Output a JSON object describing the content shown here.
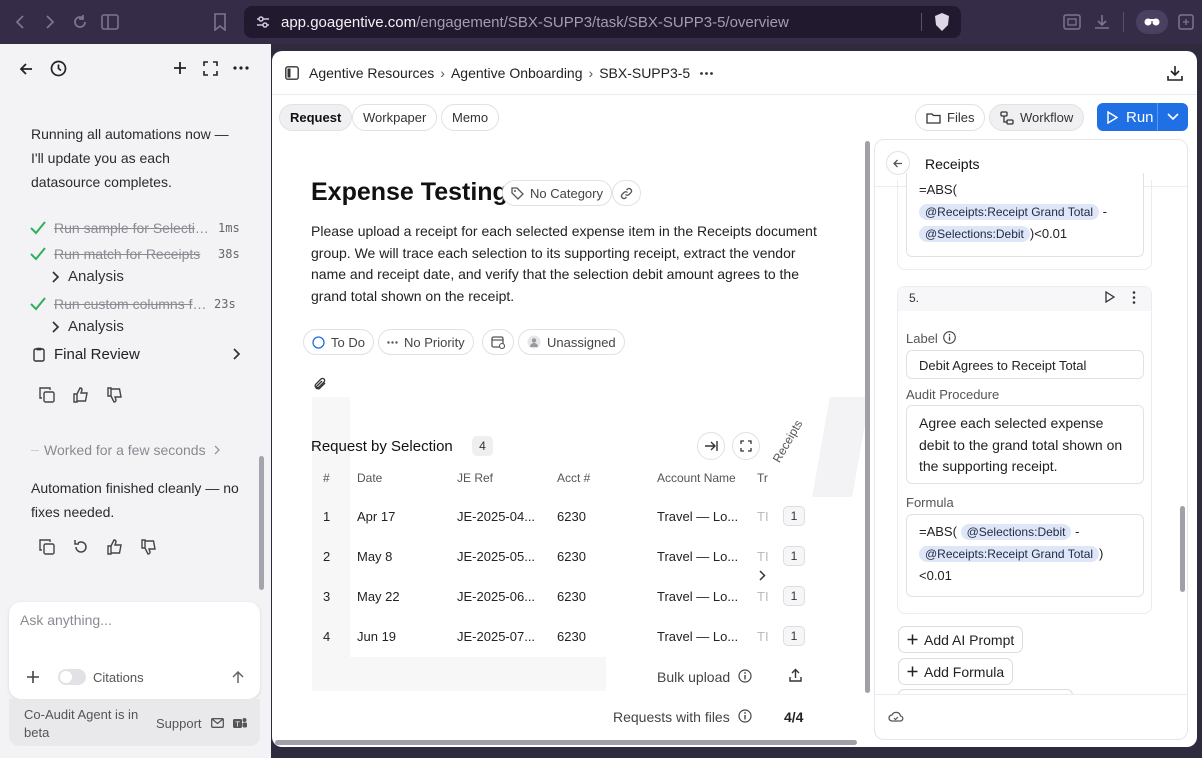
{
  "browser": {
    "url_host": "app.goagentive.com",
    "url_path": "/engagement/SBX-SUPP3/task/SBX-SUPP3-5/overview"
  },
  "left_panel": {
    "intro_lines": [
      "Running all automations now —",
      "I'll update you as each",
      "datasource completes."
    ],
    "steps": [
      {
        "name": "Run sample for Selections",
        "duration": "1ms"
      },
      {
        "name": "Run match for Receipts",
        "duration": "38s"
      },
      {
        "name": "Run custom columns for Selections",
        "duration": "23s"
      }
    ],
    "analysis_label": "Analysis",
    "final_review_label": "Final Review",
    "worked_label": "Worked for a few seconds",
    "finished_lines": [
      "Automation finished cleanly — no",
      "fixes needed."
    ],
    "chat_placeholder": "Ask anything...",
    "citations_label": "Citations",
    "footer_note_lines": [
      "Co-Audit Agent is in",
      "beta"
    ],
    "support_label": "Support"
  },
  "main": {
    "breadcrumb": [
      "Agentive Resources",
      "Agentive Onboarding",
      "SBX-SUPP3-5"
    ],
    "tabs": [
      "Request",
      "Workpaper",
      "Memo"
    ],
    "files_label": "Files",
    "workflow_label": "Workflow",
    "run_label": "Run",
    "title": "Expense Testing",
    "category_label": "No Category",
    "description": "Please upload a receipt for each selected expense item in the Receipts document group. We will trace each selection to its supporting receipt, extract the vendor name and receipt date, and verify that the selection debit amount agrees to the grand total shown on the receipt.",
    "status_label": "To Do",
    "priority_label": "No Priority",
    "assignee_label": "Unassigned",
    "table_title": "Request by Selection",
    "table_count": "4",
    "columns": [
      "#",
      "Date",
      "JE Ref",
      "Acct #",
      "Account Name",
      "Tr",
      "Receipts"
    ],
    "rows": [
      {
        "n": "1",
        "date": "Apr 17",
        "je": "JE-2025-04...",
        "acct": "6230",
        "name": "Travel — Lo...",
        "tr": "TI",
        "receipts": "1"
      },
      {
        "n": "2",
        "date": "May 8",
        "je": "JE-2025-05...",
        "acct": "6230",
        "name": "Travel — Lo...",
        "tr": "TI",
        "receipts": "1"
      },
      {
        "n": "3",
        "date": "May 22",
        "je": "JE-2025-06...",
        "acct": "6230",
        "name": "Travel — Lo...",
        "tr": "TI",
        "receipts": "1"
      },
      {
        "n": "4",
        "date": "Jun 19",
        "je": "JE-2025-07...",
        "acct": "6230",
        "name": "Travel — Lo...",
        "tr": "TI",
        "receipts": "1"
      }
    ],
    "bulk_upload_label": "Bulk upload",
    "requests_with_files_label": "Requests with files",
    "requests_with_files_value": "4/4"
  },
  "right_panel": {
    "title": "Receipts",
    "formula_prev_prefix": "=ABS(",
    "formula_prev_token1": "@Receipts:Receipt Grand Total",
    "formula_prev_dash": " -",
    "formula_prev_token2": "@Selections:Debit",
    "formula_prev_suffix": ")<0.01",
    "step_number": "5.",
    "label_heading": "Label",
    "label_value": "Debit Agrees to Receipt Total",
    "audit_heading": "Audit Procedure",
    "audit_value": "Agree each selected expense debit to the grand total shown on the supporting receipt.",
    "formula_heading": "Formula",
    "formula_prefix": "=ABS(",
    "formula_token1": "@Selections:Debit",
    "formula_dash": " -",
    "formula_token2": "@Receipts:Receipt Grand Total",
    "formula_close": ")",
    "formula_suffix": "<0.01",
    "add_ai_prompt_label": "Add AI Prompt",
    "add_formula_label": "Add Formula"
  },
  "colors": {
    "accent": "#1f6fe5",
    "check": "#2fae5b",
    "chrome": "#352d47"
  }
}
